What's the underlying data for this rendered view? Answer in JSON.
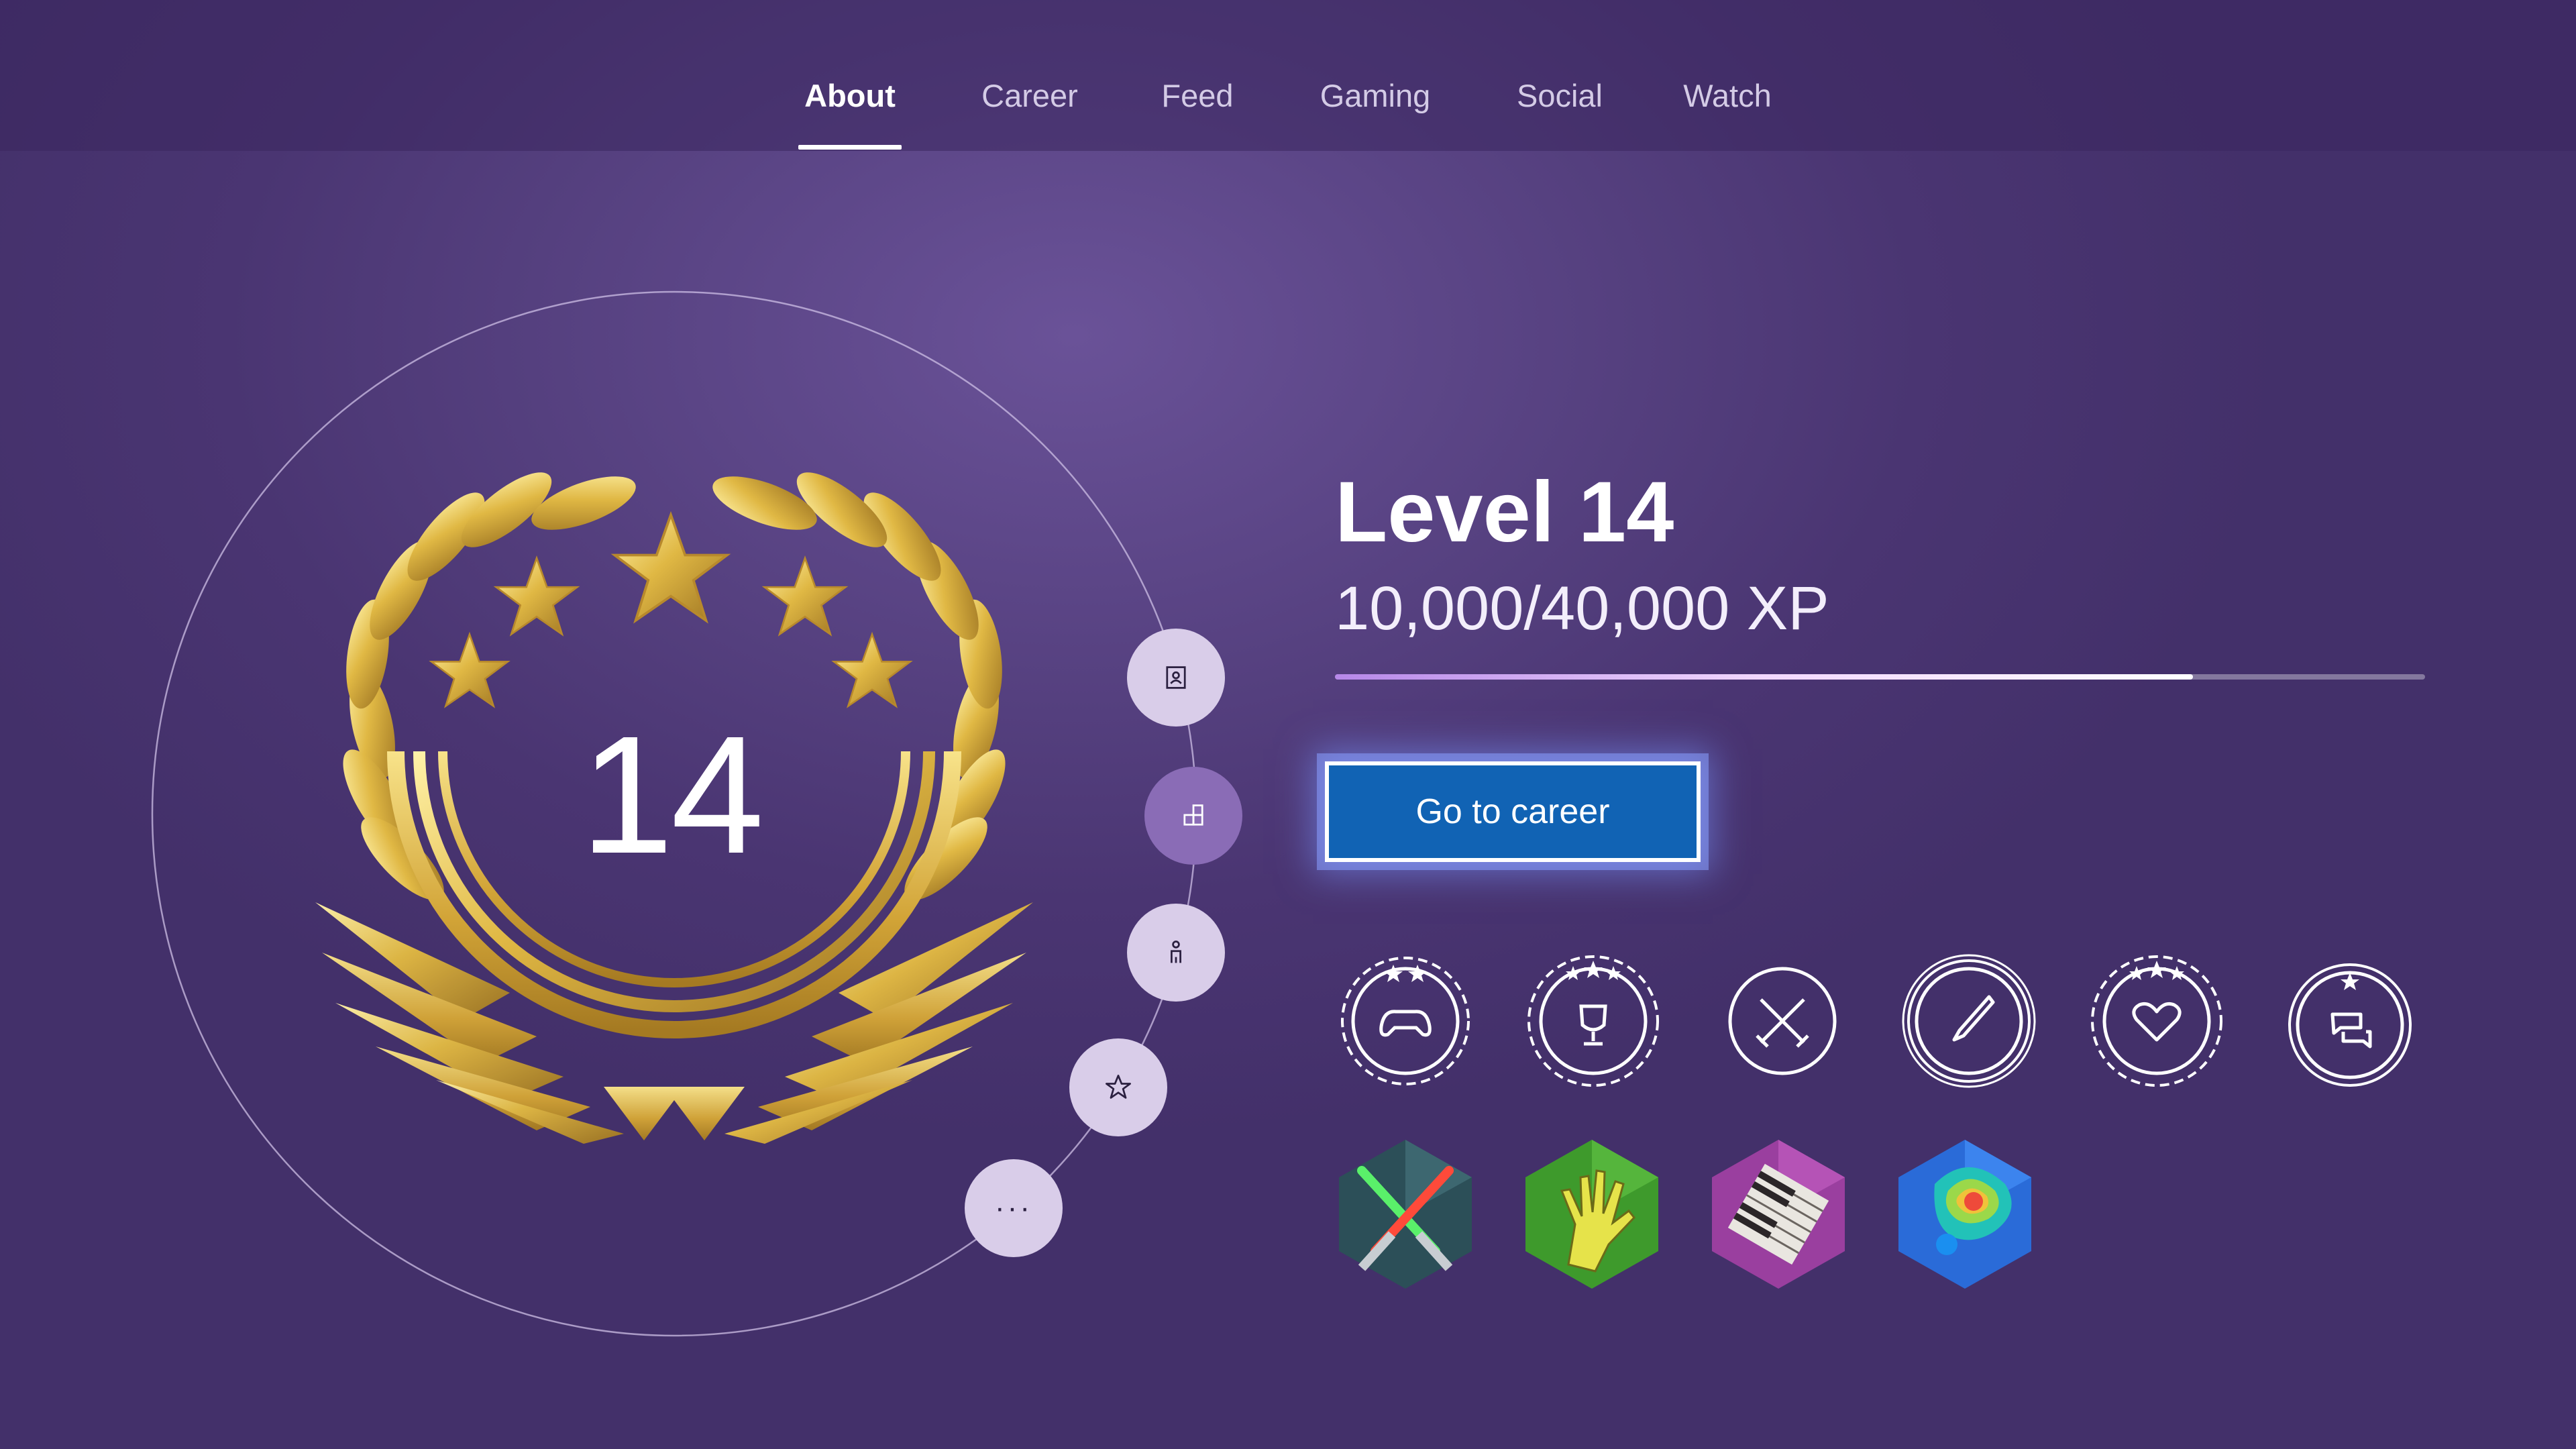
{
  "tabs": [
    {
      "label": "About",
      "active": true
    },
    {
      "label": "Career",
      "active": false
    },
    {
      "label": "Feed",
      "active": false
    },
    {
      "label": "Gaming",
      "active": false
    },
    {
      "label": "Social",
      "active": false
    },
    {
      "label": "Watch",
      "active": false
    }
  ],
  "level": {
    "number": "14",
    "title": "Level 14",
    "xp_text": "10,000/40,000 XP",
    "progress_fraction": 0.787
  },
  "side_buttons": [
    {
      "icon": "profile-card-icon",
      "selected": false
    },
    {
      "icon": "blocks-icon",
      "selected": true
    },
    {
      "icon": "person-icon",
      "selected": false
    },
    {
      "icon": "star-icon",
      "selected": false
    },
    {
      "icon": "more-icon",
      "label": "···",
      "selected": false
    }
  ],
  "career_button": {
    "label": "Go to career"
  },
  "badges": [
    {
      "icon": "controller-laurel-badge-icon"
    },
    {
      "icon": "trophy-laurel-badge-icon"
    },
    {
      "icon": "crossed-swords-badge-icon"
    },
    {
      "icon": "paintbrush-badge-icon"
    },
    {
      "icon": "heart-laurel-badge-icon"
    },
    {
      "icon": "chat-star-badge-icon"
    }
  ],
  "game_badges": [
    {
      "icon": "lightsabers-hex-badge-icon"
    },
    {
      "icon": "monster-hand-hex-badge-icon"
    },
    {
      "icon": "piano-keys-hex-badge-icon"
    },
    {
      "icon": "paint-splash-hex-badge-icon"
    }
  ],
  "colors": {
    "background": "#55407f",
    "nav_bar": "#3a265e",
    "button": "#1163b4",
    "gold": "#d9b23c",
    "side_button": "#d9cde9",
    "side_button_selected": "#8a6cb6"
  }
}
